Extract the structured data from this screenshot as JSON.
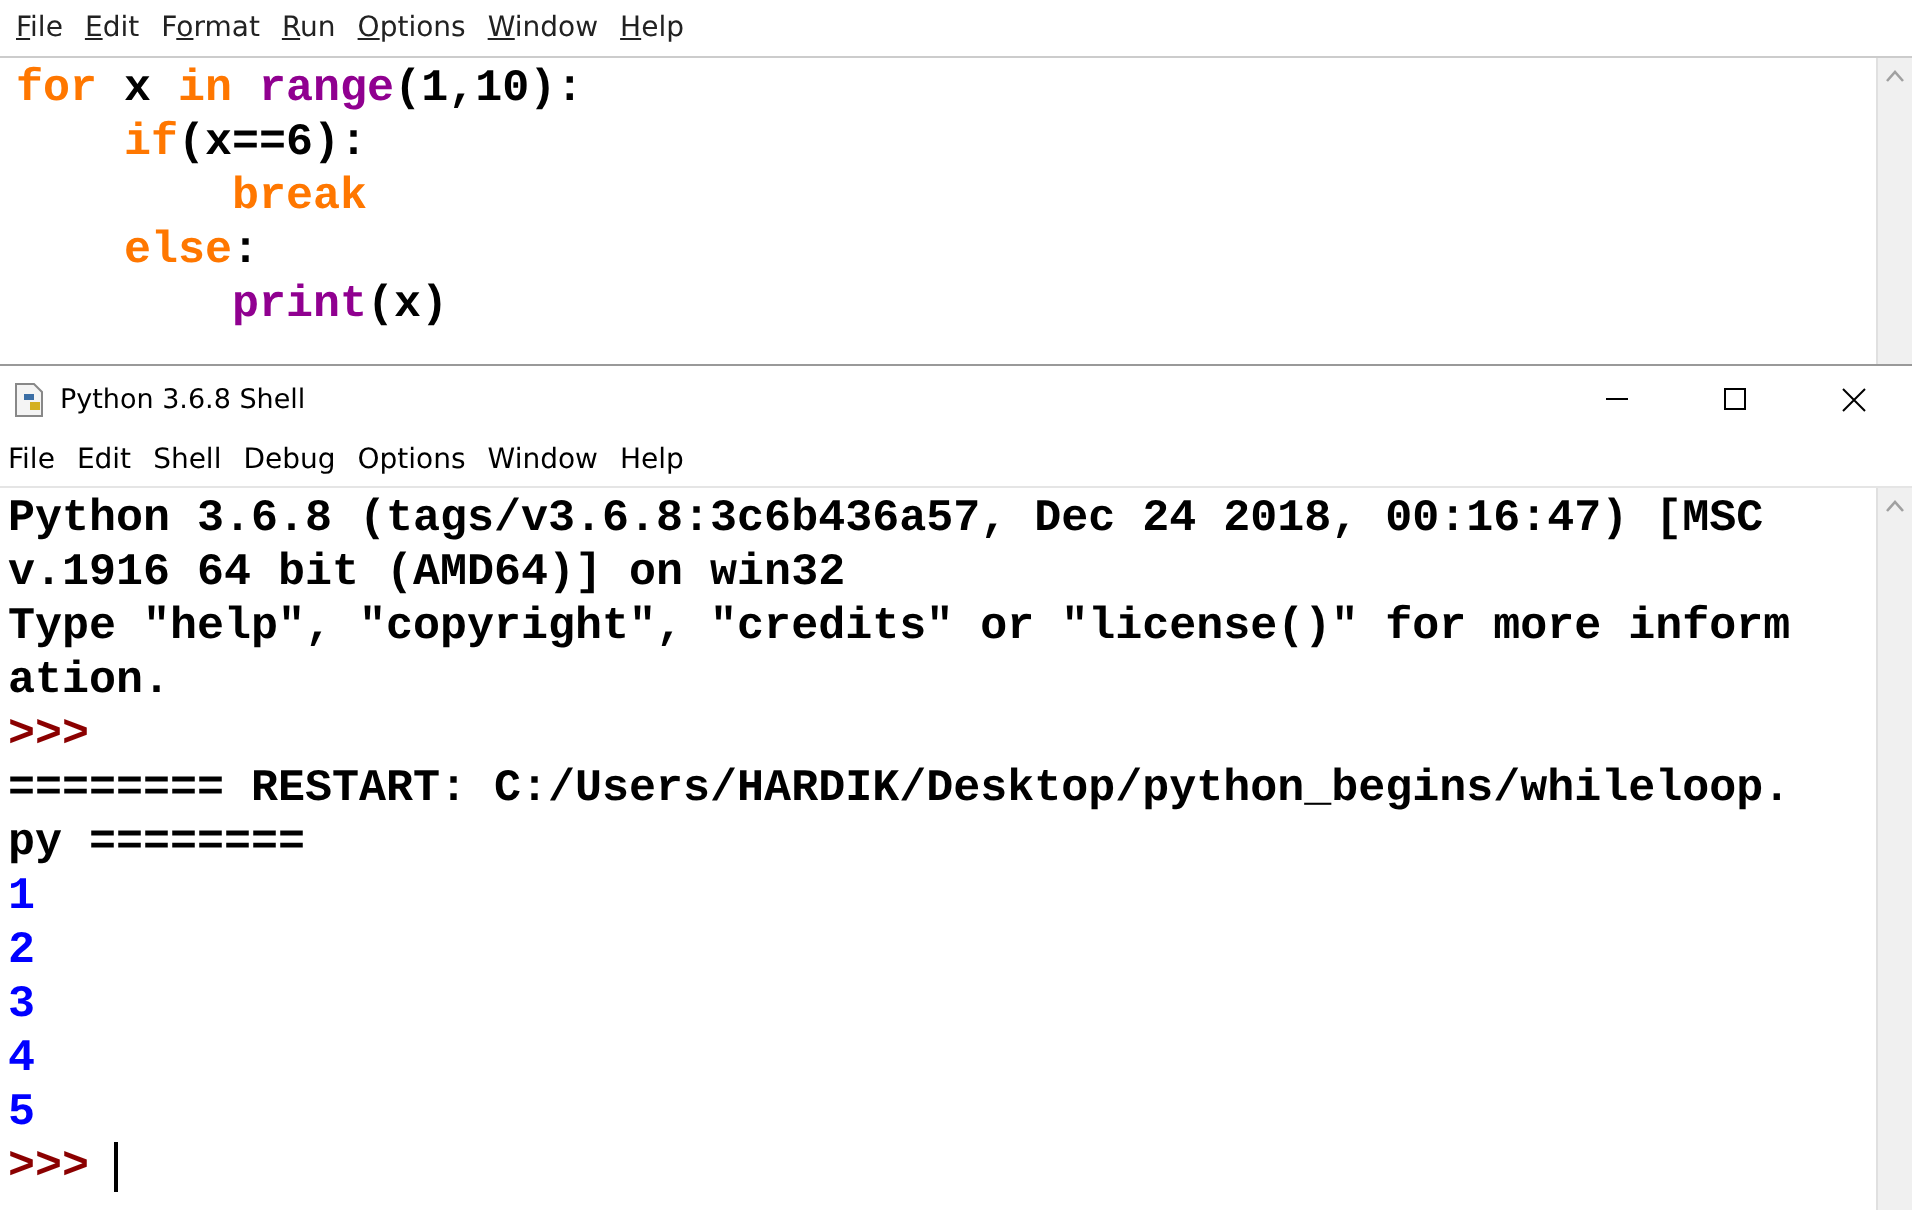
{
  "editor": {
    "menu": [
      {
        "parts": [
          {
            "text": "F",
            "underlined": true
          },
          {
            "text": "ile",
            "underlined": false
          }
        ]
      },
      {
        "parts": [
          {
            "text": "E",
            "underlined": true
          },
          {
            "text": "dit",
            "underlined": false
          }
        ]
      },
      {
        "parts": [
          {
            "text": "F",
            "underlined": false
          },
          {
            "text": "o",
            "underlined": true
          },
          {
            "text": "rmat",
            "underlined": false
          }
        ]
      },
      {
        "parts": [
          {
            "text": "R",
            "underlined": true
          },
          {
            "text": "un",
            "underlined": false
          }
        ]
      },
      {
        "parts": [
          {
            "text": "O",
            "underlined": true
          },
          {
            "text": "ptions",
            "underlined": false
          }
        ]
      },
      {
        "parts": [
          {
            "text": "W",
            "underlined": true
          },
          {
            "text": "indow",
            "underlined": false
          }
        ]
      },
      {
        "parts": [
          {
            "text": "H",
            "underlined": true
          },
          {
            "text": "elp",
            "underlined": false
          }
        ]
      }
    ],
    "code_lines": [
      {
        "tokens": [
          {
            "kind": "keyword",
            "text": "for"
          },
          {
            "kind": "plain",
            "text": " x "
          },
          {
            "kind": "keyword",
            "text": "in"
          },
          {
            "kind": "builtin",
            "text": " range"
          },
          {
            "kind": "plain",
            "text": "(1,10):"
          }
        ]
      },
      {
        "tokens": [
          {
            "kind": "keyword",
            "text": "    if"
          },
          {
            "kind": "plain",
            "text": "(x==6):"
          }
        ]
      },
      {
        "tokens": [
          {
            "kind": "keyword",
            "text": "        break"
          }
        ]
      },
      {
        "tokens": [
          {
            "kind": "keyword",
            "text": "    else"
          },
          {
            "kind": "plain",
            "text": ":"
          }
        ]
      },
      {
        "tokens": [
          {
            "kind": "builtin",
            "text": "        print"
          },
          {
            "kind": "plain",
            "text": "(x)"
          }
        ]
      }
    ]
  },
  "shell": {
    "title": "Python 3.6.8 Shell",
    "menu": [
      "File",
      "Edit",
      "Shell",
      "Debug",
      "Options",
      "Window",
      "Help"
    ],
    "lines": [
      {
        "kind": "info",
        "text": "Python 3.6.8 (tags/v3.6.8:3c6b436a57, Dec 24 2018, 00:16:47) [MSC"
      },
      {
        "kind": "info",
        "text": "v.1916 64 bit (AMD64)] on win32"
      },
      {
        "kind": "info",
        "text": "Type \"help\", \"copyright\", \"credits\" or \"license()\" for more inform"
      },
      {
        "kind": "info",
        "text": "ation."
      },
      {
        "kind": "prompt",
        "text": ">>>"
      },
      {
        "kind": "info",
        "text": "======== RESTART: C:/Users/HARDIK/Desktop/python_begins/whileloop."
      },
      {
        "kind": "info",
        "text": "py ========"
      },
      {
        "kind": "stdout",
        "text": "1"
      },
      {
        "kind": "stdout",
        "text": "2"
      },
      {
        "kind": "stdout",
        "text": "3"
      },
      {
        "kind": "stdout",
        "text": "4"
      },
      {
        "kind": "stdout",
        "text": "5"
      },
      {
        "kind": "prompt",
        "text": ">>>",
        "cursor": true
      }
    ]
  }
}
